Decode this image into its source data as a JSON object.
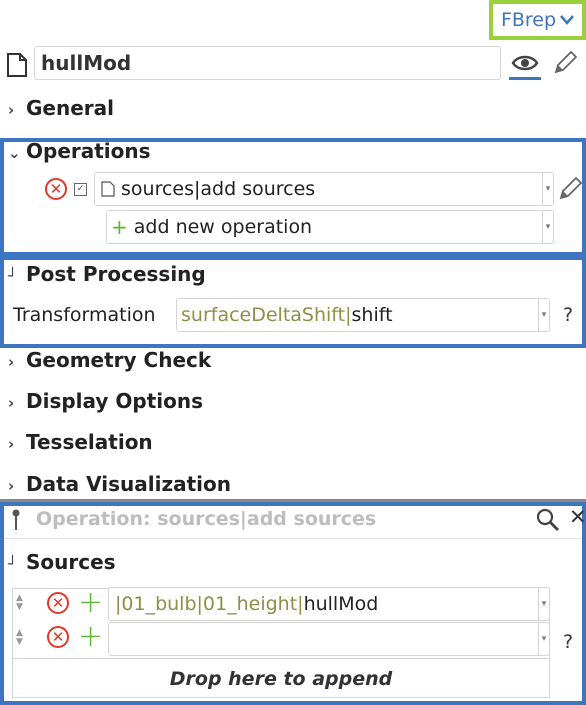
{
  "header": {
    "dropdown_label": "FBrep",
    "object_name": "hullMod"
  },
  "sections": {
    "general": "General",
    "operations": "Operations",
    "post_processing": "Post Processing",
    "geometry_check": "Geometry Check",
    "display_options": "Display Options",
    "tesselation": "Tesselation",
    "data_visualization": "Data Visualization"
  },
  "operations": {
    "items": [
      {
        "label": "sources|add sources"
      }
    ],
    "add_new_label": "add new operation"
  },
  "post_processing": {
    "transformation_label": "Transformation",
    "value_prefix": "surfaceDeltaShift|",
    "value_main": "shift",
    "help": "?"
  },
  "operation_panel": {
    "title": "Operation: sources|add sources",
    "sources_label": "Sources",
    "sources": [
      {
        "prefix": "|01_bulb|01_height|",
        "main": "hullMod"
      },
      {
        "prefix": "",
        "main": ""
      }
    ],
    "help": "?",
    "drop_label": "Drop here to append"
  },
  "colors": {
    "highlight_green": "#9ad03c",
    "highlight_blue": "#3d75c0",
    "remove_red": "#e2382b",
    "add_green": "#5bb82b",
    "link_blue": "#3d75c0"
  }
}
